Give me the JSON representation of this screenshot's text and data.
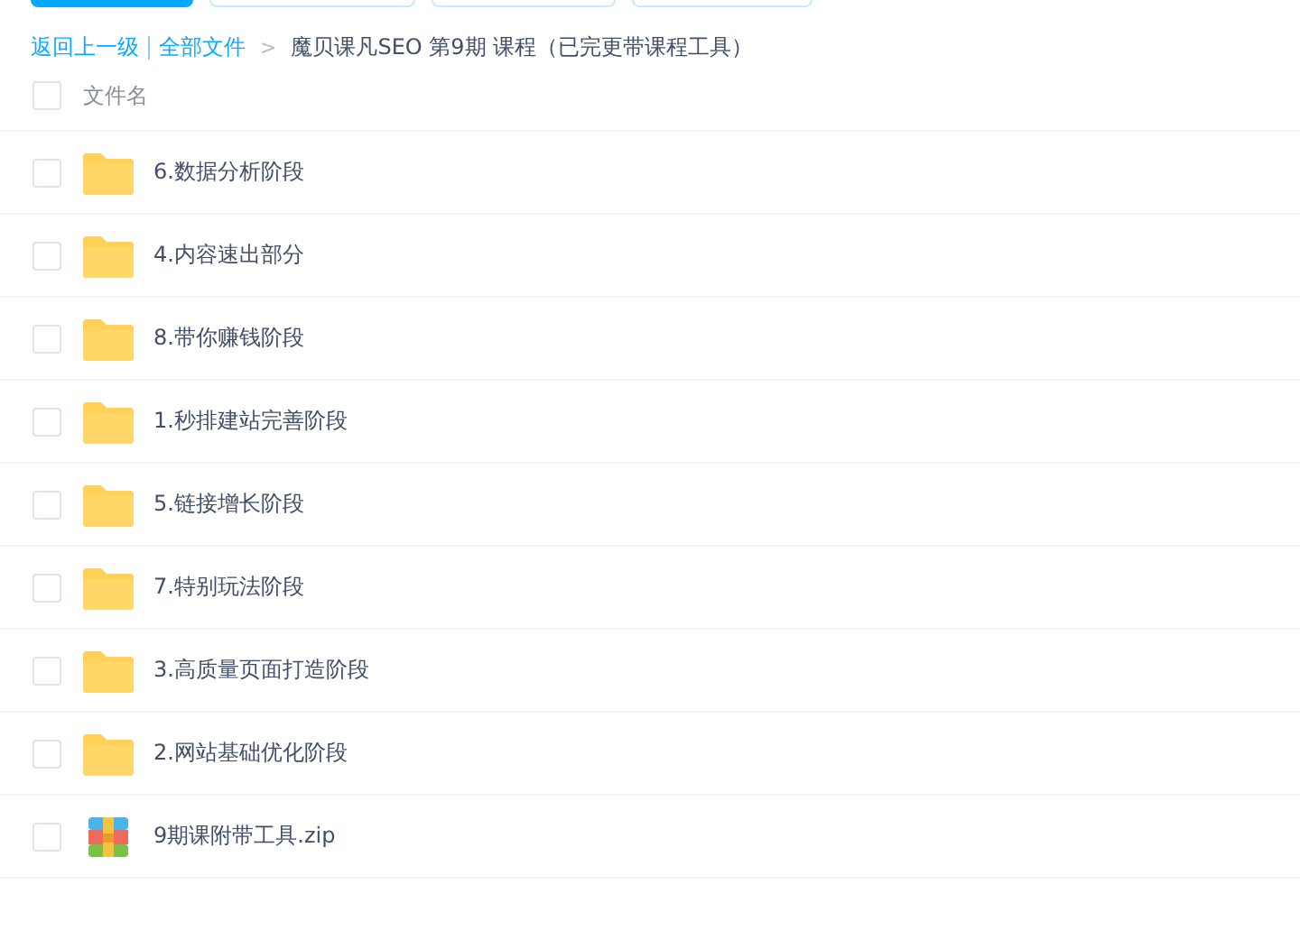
{
  "toolbar_buttons": [
    {
      "kind": "primary"
    },
    {
      "kind": "plain"
    },
    {
      "kind": "plain"
    },
    {
      "kind": "plain"
    }
  ],
  "breadcrumb": {
    "back": "返回上一级",
    "root": "全部文件",
    "separator": ">",
    "current": "魔贝课凡SEO 第9期 课程（已完更带课程工具）"
  },
  "header": {
    "checked": false,
    "label": "文件名"
  },
  "files": [
    {
      "kind": "folder",
      "name": "6.数据分析阶段",
      "checked": false
    },
    {
      "kind": "folder",
      "name": "4.内容速出部分",
      "checked": false
    },
    {
      "kind": "folder",
      "name": "8.带你赚钱阶段",
      "checked": false
    },
    {
      "kind": "folder",
      "name": "1.秒排建站完善阶段",
      "checked": false
    },
    {
      "kind": "folder",
      "name": "5.链接增长阶段",
      "checked": false
    },
    {
      "kind": "folder",
      "name": "7.特别玩法阶段",
      "checked": false
    },
    {
      "kind": "folder",
      "name": "3.高质量页面打造阶段",
      "checked": false
    },
    {
      "kind": "folder",
      "name": "2.网站基础优化阶段",
      "checked": false
    },
    {
      "kind": "archive",
      "name": "9期课附带工具.zip",
      "checked": false
    }
  ]
}
